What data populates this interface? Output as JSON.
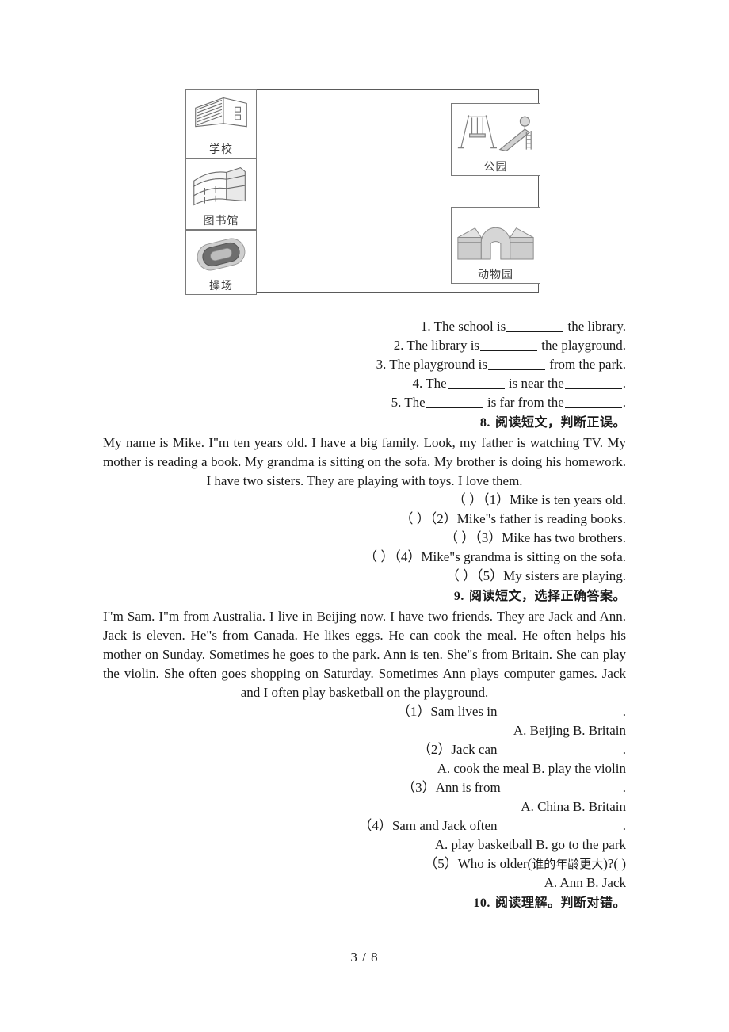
{
  "map": {
    "name": "neighbourhood-map-diagram",
    "cells": [
      {
        "key": "school",
        "label": "学校",
        "icon": "school-building-icon"
      },
      {
        "key": "library",
        "label": "图书馆",
        "icon": "library-building-icon"
      },
      {
        "key": "playground",
        "label": "操场",
        "icon": "playground-track-icon"
      },
      {
        "key": "park",
        "label": "公园",
        "icon": "park-swing-slide-icon"
      },
      {
        "key": "zoo",
        "label": "动物园",
        "icon": "zoo-gate-icon"
      }
    ]
  },
  "fill_in_exercise": {
    "items": [
      {
        "prefix": "1. The school is",
        "suffix": "the library."
      },
      {
        "prefix": "2. The library is",
        "suffix": "the playground."
      },
      {
        "prefix": "3. The playground is",
        "suffix": "from the park."
      },
      {
        "prefix": "4. The",
        "middle": "is near the",
        "suffix": "."
      },
      {
        "prefix": "5. The",
        "middle": "is far from the",
        "suffix": "."
      }
    ]
  },
  "question8": {
    "number": "8.",
    "heading": "阅读短文，判断正误。",
    "passage": "My name is Mike. I\"m ten years old. I have a big family. Look, my father is watching TV. My mother is reading a book. My grandma is sitting on the sofa. My brother is doing his homework. I have two sisters. They are playing with toys. I love them.",
    "items": [
      "（   ）（1）Mike is ten years old.",
      "（   ）（2）Mike\"s father is reading books.",
      "（   ）（3）Mike has two brothers.",
      "（   ）（4）Mike\"s grandma is sitting on the sofa.",
      "（   ）（5）My sisters are playing."
    ]
  },
  "question9": {
    "number": "9.",
    "heading": "阅读短文，选择正确答案。",
    "passage": "I\"m Sam. I\"m from Australia. I live in Beijing now. I have two friends. They are Jack and Ann. Jack is eleven. He\"s from Canada. He likes eggs. He can cook the meal. He often helps his mother on Sunday. Sometimes he goes to the park. Ann is ten. She\"s from Britain. She can play the violin. She often goes shopping on Saturday. Sometimes Ann plays computer games. Jack and I often play basketball on the playground.",
    "items": [
      {
        "stem": "（1）Sam lives in",
        "tail": ".",
        "options": "A. Beijing   B. Britain"
      },
      {
        "stem": "（2）Jack can",
        "tail": ".",
        "options": "A. cook the meal   B. play the violin"
      },
      {
        "stem": "（3）Ann is from",
        "tail": ".",
        "options": "A. China   B. Britain"
      },
      {
        "stem": "（4）Sam and Jack often",
        "tail": ".",
        "options": "A. play basketball   B. go to the park"
      }
    ],
    "item5": {
      "text_before": "（5）Who is older(",
      "cn": "谁的年龄更大",
      "text_after": ")?(   )",
      "options": "A. Ann   B. Jack"
    }
  },
  "question10": {
    "number": "10.",
    "heading": "阅读理解。判断对错。"
  },
  "footer": {
    "page_indicator": "3 / 8"
  }
}
